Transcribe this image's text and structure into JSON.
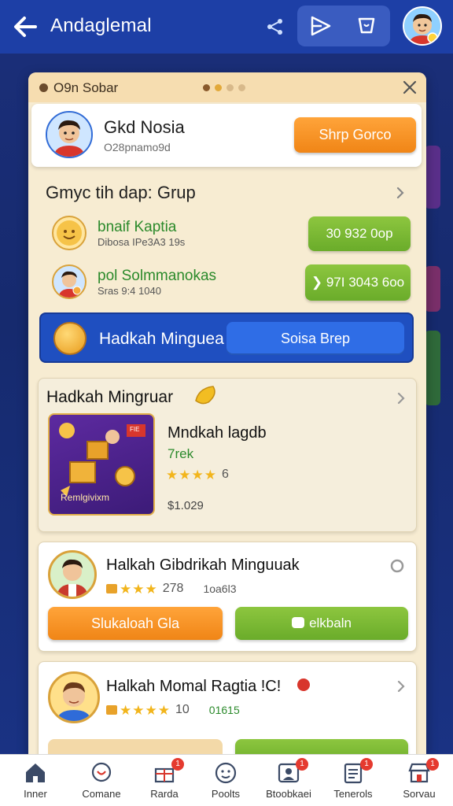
{
  "header": {
    "title": "Andaglemal",
    "back_icon": "back-arrow-icon",
    "share_icon": "share-icon",
    "play_icon": "play-icon",
    "cup_icon": "cup-icon"
  },
  "panel": {
    "header_title": "O9n Sobar",
    "pager_count": 4,
    "pager_active": 1
  },
  "profile": {
    "name": "Gkd Nosia",
    "sub": "O28pnamo9d",
    "button": "Shrp Gorco"
  },
  "group": {
    "title": "Gmyc tih dap: Grup",
    "rows": [
      {
        "name": "bnaif Kaptia",
        "sub": "Dibosa IPe3A3 19s",
        "button": "30 932 0op"
      },
      {
        "name": "pol Solmmanokas",
        "sub": "Sras 9:4 1040",
        "button": "97I 3043 6oo"
      }
    ]
  },
  "banner": {
    "title": "Hadkah Minguea",
    "button": "Soisa Brep"
  },
  "weekly": {
    "title": "Hadkah Mingruar",
    "promo_label": "Remlgivixm",
    "promo_badge": "FIE",
    "item_title": "Mndkah lagdb",
    "item_sub": "7rek",
    "rating_stars": 4,
    "rating_value": "6",
    "price": "$1.029"
  },
  "card1": {
    "title": "Halkah Gibdrikah Minguuak",
    "rating_stars": 3,
    "count": "278",
    "code": "1oa6l3",
    "btn_left": "Slukaloah Gla",
    "btn_right": "elkbaln"
  },
  "card2": {
    "title": "Halkah Momal Ragtia !C!",
    "rating_stars": 4,
    "count": "10",
    "code": "01615"
  },
  "nav": [
    {
      "label": "Inner",
      "icon": "home-icon",
      "badge": ""
    },
    {
      "label": "Comane",
      "icon": "chat-icon",
      "badge": ""
    },
    {
      "label": "Rarda",
      "icon": "gift-icon",
      "badge": "1"
    },
    {
      "label": "Poolts",
      "icon": "face-icon",
      "badge": ""
    },
    {
      "label": "Btoobkaei",
      "icon": "people-icon",
      "badge": "1"
    },
    {
      "label": "Tenerols",
      "icon": "list-icon",
      "badge": "1"
    },
    {
      "label": "Sorvau",
      "icon": "shop-icon",
      "badge": "1"
    }
  ],
  "colors": {
    "header_bg": "#1d3fa6",
    "panel_bg": "#f7ecd2",
    "accent_orange": "#f08516",
    "accent_green": "#6aac2a",
    "banner_blue": "#1f4fc0"
  }
}
